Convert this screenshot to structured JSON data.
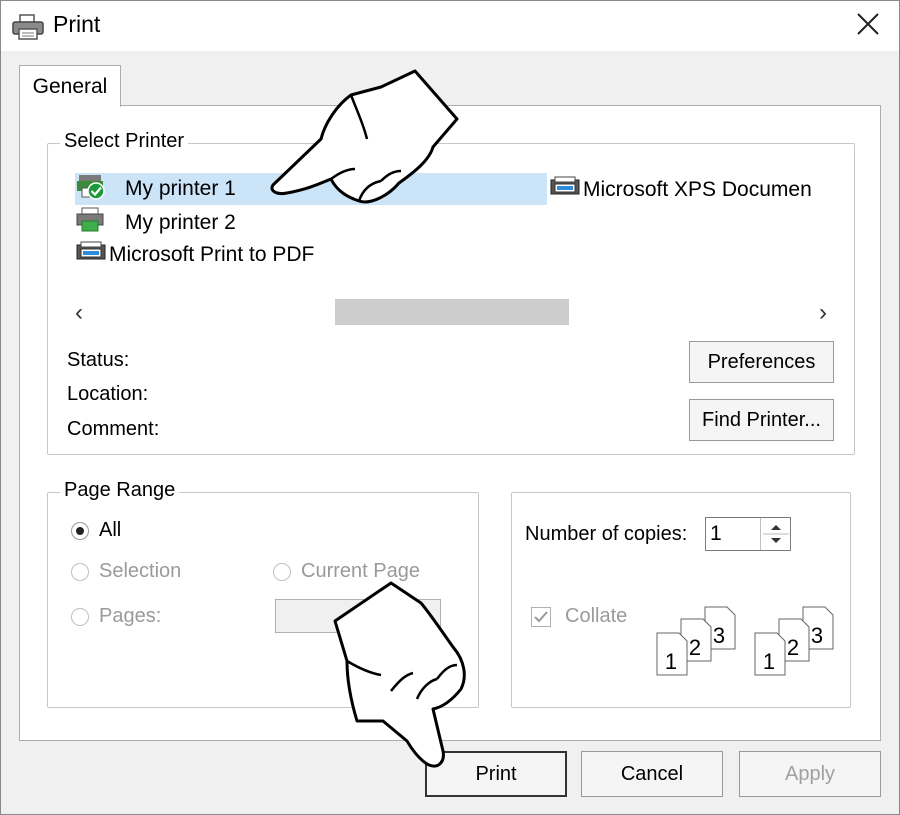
{
  "window": {
    "title": "Print",
    "close_glyph": "✕"
  },
  "tabs": [
    {
      "label": "General"
    }
  ],
  "select_printer": {
    "group_title": "Select Printer",
    "printers": [
      {
        "name": "My printer 1",
        "selected": true,
        "icon": "printer-default-icon"
      },
      {
        "name": "My printer 2",
        "selected": false,
        "icon": "printer-icon"
      },
      {
        "name": "Microsoft Print to PDF",
        "selected": false,
        "icon": "printer-icon"
      },
      {
        "name": "Microsoft XPS Documen",
        "selected": false,
        "icon": "printer-icon"
      }
    ],
    "scroll_left": "‹",
    "scroll_right": "›",
    "status_label": "Status:",
    "location_label": "Location:",
    "comment_label": "Comment:",
    "preferences_button": "Preferences",
    "find_printer_button": "Find Printer..."
  },
  "page_range": {
    "group_title": "Page Range",
    "options": {
      "all": "All",
      "selection": "Selection",
      "current_page": "Current Page",
      "pages": "Pages:"
    },
    "selected": "all"
  },
  "copies": {
    "label": "Number of copies:",
    "value": "1",
    "collate_label": "Collate",
    "collate_checked": true,
    "collate_pages": [
      "1",
      "2",
      "3"
    ]
  },
  "buttons": {
    "print": "Print",
    "cancel": "Cancel",
    "apply": "Apply"
  }
}
